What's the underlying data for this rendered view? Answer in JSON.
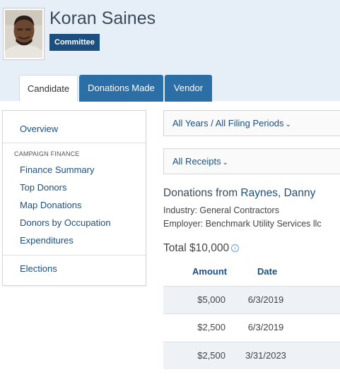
{
  "profile": {
    "name": "Koran Saines",
    "badge": "Committee"
  },
  "tabs": [
    {
      "label": "Candidate",
      "active": true
    },
    {
      "label": "Donations Made",
      "active": false
    },
    {
      "label": "Vendor",
      "active": false
    }
  ],
  "sidebar": {
    "overview": "Overview",
    "section_heading": "CAMPAIGN FINANCE",
    "items": [
      "Finance Summary",
      "Top Donors",
      "Map Donations",
      "Donors by Occupation",
      "Expenditures"
    ],
    "elections": "Elections"
  },
  "filters": {
    "period": "All Years / All Filing Periods",
    "receipts": "All Receipts"
  },
  "donor": {
    "prefix": "Donations from ",
    "name": "Raynes, Danny",
    "industry": "Industry: General Contractors",
    "employer": "Employer: Benchmark Utility Services llc",
    "total": "Total $10,000"
  },
  "table": {
    "headers": {
      "amount": "Amount",
      "date": "Date"
    },
    "rows": [
      {
        "amount": "$5,000",
        "date": "6/3/2019"
      },
      {
        "amount": "$2,500",
        "date": "6/3/2019"
      },
      {
        "amount": "$2,500",
        "date": "3/31/2023"
      }
    ]
  },
  "colors": {
    "header_band": "#e6eef8",
    "tab_blue": "#2c6ea6",
    "badge_navy": "#1a4f80",
    "link_blue": "#1d4f7f"
  },
  "icons": {
    "chevron": "chevron-down-icon",
    "info": "info-icon"
  }
}
